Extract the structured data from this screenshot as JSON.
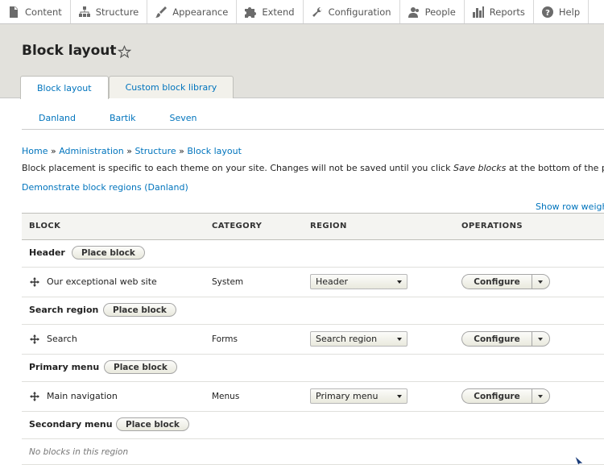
{
  "toolbar": {
    "items": [
      {
        "label": "Content",
        "icon": "file-icon"
      },
      {
        "label": "Structure",
        "icon": "structure-icon"
      },
      {
        "label": "Appearance",
        "icon": "paintbrush-icon"
      },
      {
        "label": "Extend",
        "icon": "puzzle-icon"
      },
      {
        "label": "Configuration",
        "icon": "wrench-icon"
      },
      {
        "label": "People",
        "icon": "people-icon"
      },
      {
        "label": "Reports",
        "icon": "bar-chart-icon"
      },
      {
        "label": "Help",
        "icon": "help-icon"
      }
    ]
  },
  "page": {
    "title": "Block layout",
    "tabs": [
      "Block layout",
      "Custom block library"
    ],
    "theme_tabs": [
      "Danland",
      "Bartik",
      "Seven"
    ],
    "breadcrumb": [
      "Home",
      "Administration",
      "Structure",
      "Block layout"
    ],
    "description_before": "Block placement is specific to each theme on your site. Changes will not be saved until you click ",
    "description_em": "Save blocks",
    "description_after": " at the bottom of the page.",
    "demo_link": "Demonstrate block regions (Danland)",
    "row_weights_link": "Show row weights"
  },
  "table": {
    "headers": [
      "BLOCK",
      "CATEGORY",
      "REGION",
      "OPERATIONS"
    ],
    "place_block_label": "Place block",
    "configure_label": "Configure",
    "regions": [
      {
        "name": "Header",
        "blocks": [
          {
            "name": "Our exceptional web site",
            "category": "System",
            "region": "Header"
          }
        ]
      },
      {
        "name": "Search region",
        "blocks": [
          {
            "name": "Search",
            "category": "Forms",
            "region": "Search region"
          }
        ]
      },
      {
        "name": "Primary menu",
        "blocks": [
          {
            "name": "Main navigation",
            "category": "Menus",
            "region": "Primary menu"
          }
        ]
      },
      {
        "name": "Secondary menu",
        "blocks": [],
        "empty_text": "No blocks in this region"
      }
    ]
  },
  "colors": {
    "link": "#0074bd",
    "header_bg": "#e2e1dc",
    "table_head_bg": "#f4f4f1"
  }
}
